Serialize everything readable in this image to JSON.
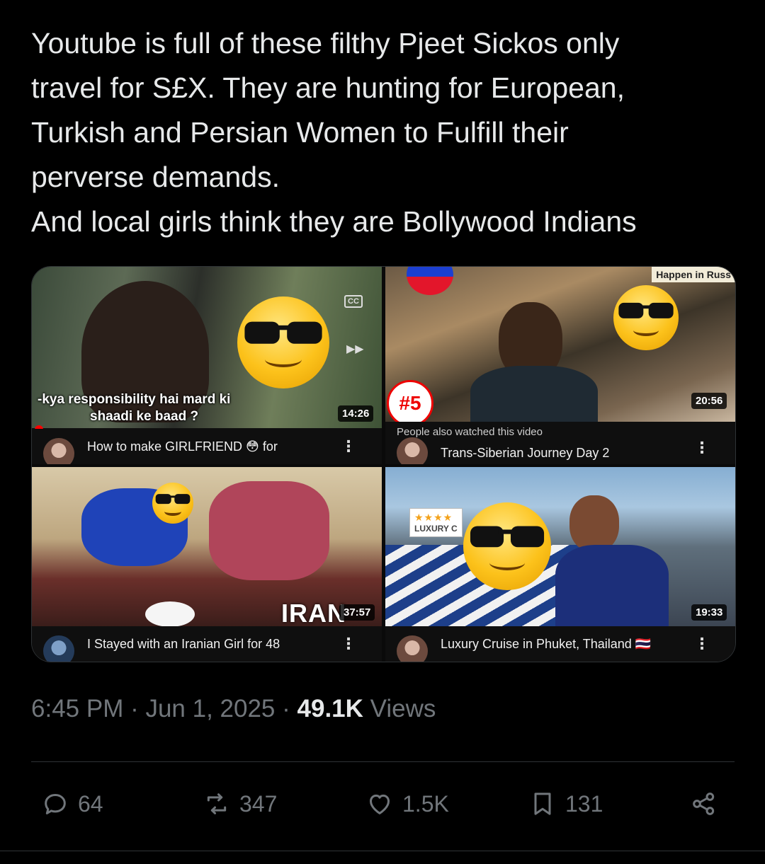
{
  "tweet": {
    "text_lines": [
      "Youtube is full of these filthy Pjeet Sickos only",
      "travel for S£X. They are hunting for European,",
      "Turkish and Persian Women to Fulfill their",
      "perverse demands.",
      "And local girls think they are Bollywood Indians"
    ]
  },
  "media": {
    "video1": {
      "caption_line1": "-kya responsibility hai mard ki",
      "caption_line2": "shaadi ke baad ?",
      "cc": "CC",
      "duration": "14:26",
      "title": "How to make GIRLFRIEND 😳 for"
    },
    "video2": {
      "banner": "Happen in Russ",
      "rank_badge": "#5",
      "duration": "20:56",
      "also_watched": "People also watched this video",
      "title": "Trans-Siberian Journey Day 2"
    },
    "video3": {
      "overlay_text": "IRAN",
      "duration": "37:57",
      "title": "I Stayed with an Iranian Girl for 48"
    },
    "video4": {
      "tag_stars": "★★★★",
      "tag_text": "LUXURY C",
      "duration": "19:33",
      "title": "Luxury Cruise in Phuket, Thailand 🇹🇭"
    },
    "kebab": "⋮"
  },
  "meta": {
    "time": "6:45 PM",
    "sep1": " · ",
    "date": "Jun 1, 2025",
    "sep2": " · ",
    "views_count": "49.1K",
    "views_label": " Views"
  },
  "actions": {
    "replies": "64",
    "reposts": "347",
    "likes": "1.5K",
    "bookmarks": "131"
  },
  "icons": [
    "reply-icon",
    "repost-icon",
    "like-icon",
    "bookmark-icon",
    "share-icon"
  ]
}
